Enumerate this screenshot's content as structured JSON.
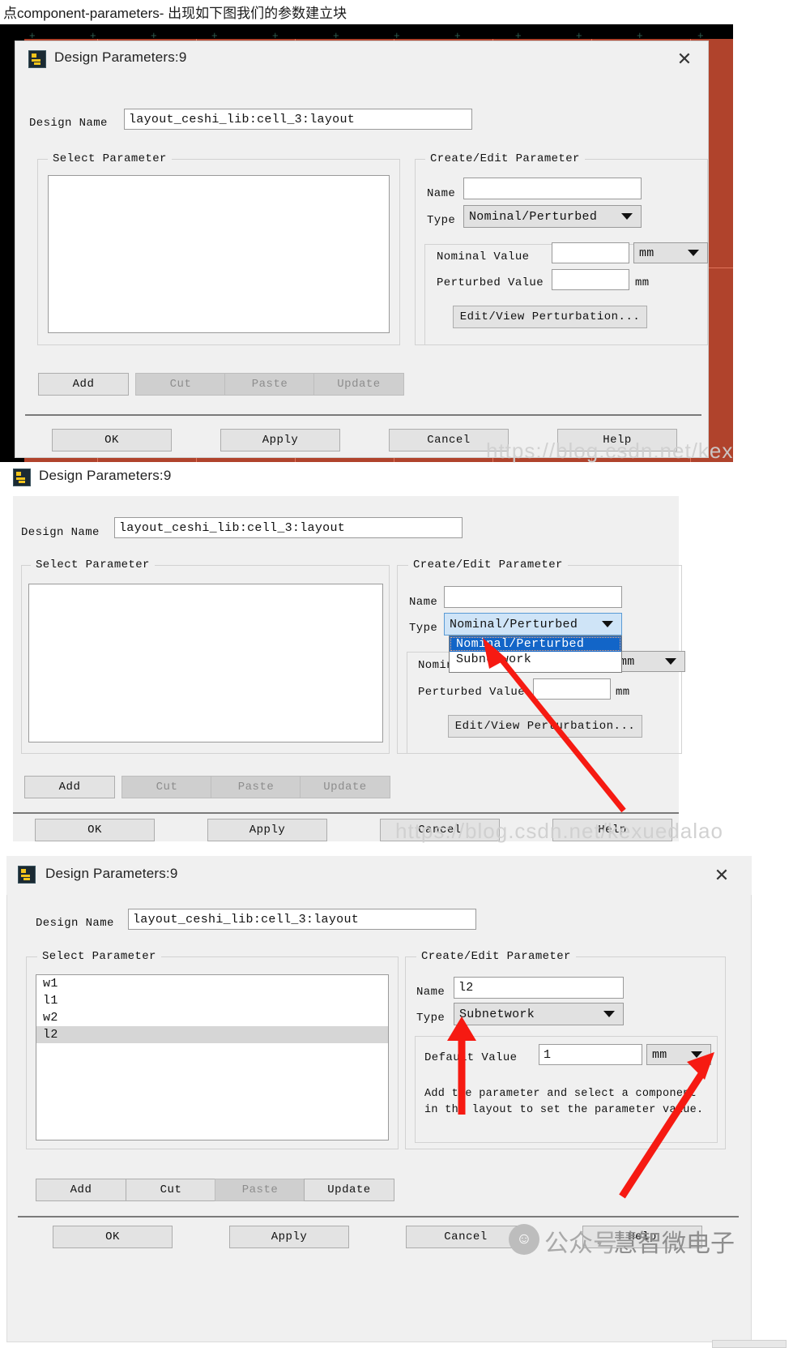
{
  "caption": "点component-parameters- 出现如下图我们的参数建立块",
  "dialog_title": "Design Parameters:9",
  "labels": {
    "design_name": "Design Name",
    "select_parameter": "Select Parameter",
    "create_edit_parameter": "Create/Edit Parameter",
    "name": "Name",
    "type": "Type",
    "nominal_value": "Nominal Value",
    "perturbed_value": "Perturbed Value",
    "default_value": "Default Value",
    "unit_mm": "mm"
  },
  "design_name_value": "layout_ceshi_lib:cell_3:layout",
  "type_options": [
    "Nominal/Perturbed",
    "Subnetwork"
  ],
  "edit_buttons": {
    "add": "Add",
    "cut": "Cut",
    "paste": "Paste",
    "update": "Update"
  },
  "action_buttons": {
    "ok": "OK",
    "apply": "Apply",
    "cancel": "Cancel",
    "help": "Help"
  },
  "perturbation_button": "Edit/View Perturbation...",
  "panel_top": {
    "name_value": "",
    "type_value": "Nominal/Perturbed",
    "nominal_value": "",
    "perturbed_value": "",
    "unit": "mm",
    "parameters": []
  },
  "panel_middle": {
    "name_value": "",
    "type_value": "Nominal/Perturbed",
    "dropdown_open": true,
    "dropdown_highlighted": "Nominal/Perturbed",
    "dropdown_second": "Subnetwork",
    "nominal_value": "",
    "perturbed_value": "",
    "unit": "mm",
    "parameters": []
  },
  "panel_bottom": {
    "name_value": "l2",
    "type_value": "Subnetwork",
    "default_value": "1",
    "unit": "mm",
    "hint_line1": "Add the parameter and select a component",
    "hint_line2": "in the layout to set the parameter value.",
    "parameters": [
      "w1",
      "l1",
      "w2",
      "l2"
    ],
    "selected_parameter": "l2"
  },
  "watermarks": {
    "csdn_top": "https://blog.csdn.net/kexuedalao",
    "csdn_middle": "https://blog.csdn.net/kexuedalao",
    "wechat_prefix": "公众号",
    "wechat_sep": ":",
    "wechat_name": "慧智微电子"
  },
  "colors": {
    "app_background": "#b0432c",
    "dialog_background": "#f0f0f0",
    "highlight_blue": "#1265c8",
    "combo_open_blue": "#cfe4f7",
    "list_selection": "#d6d6d6",
    "arrow_red": "#f61a12",
    "watermark_gray": "#cfcfcf"
  }
}
